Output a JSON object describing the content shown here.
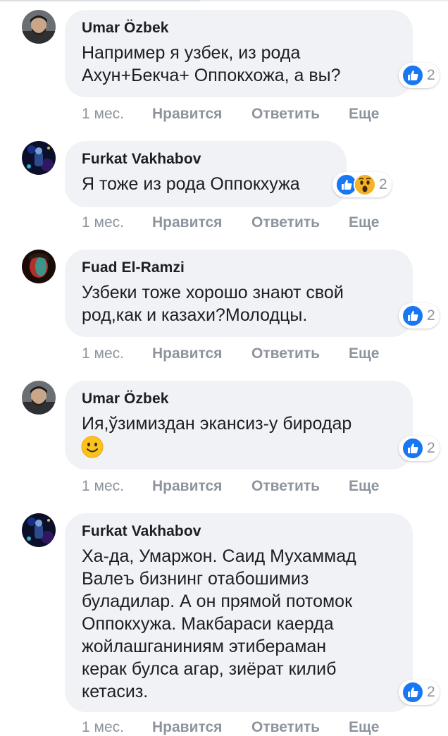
{
  "action_labels": {
    "time": "1 мес.",
    "like": "Нравится",
    "reply": "Ответить",
    "more": "Еще"
  },
  "comments": [
    {
      "author": "Umar Özbek",
      "text": "Например я узбек, из рода\nАхун+Бекча+ Оппокхожа, а вы?",
      "reaction_count": "2",
      "reactions": [
        "like-icon"
      ]
    },
    {
      "author": "Furkat Vakhabov",
      "text": "Я тоже из рода Оппокхужа",
      "reaction_count": "2",
      "reactions": [
        "like-icon",
        "wow-icon"
      ]
    },
    {
      "author": "Fuad El-Ramzi",
      "text": "Узбеки тоже хорошо знают свой\nрод,как и казахи?Молодцы.",
      "reaction_count": "2",
      "reactions": [
        "like-icon"
      ]
    },
    {
      "author": "Umar Özbek",
      "text": "Ия,ўзимиздан экансиз-у биродар",
      "emoji": "slightly-smiling-face-icon",
      "reaction_count": "2",
      "reactions": [
        "like-icon"
      ]
    },
    {
      "author": "Furkat Vakhabov",
      "text": "Ха-да, Умаржон. Саид Мухаммад\nВалеъ бизнинг отабошимиз\nбуладилар. А он прямой потомок\nОппокхужа. Макбараси каерда\nжойлашганиниям этибераман\nкерак булса агар, зиёрат килиб\nкетасиз.",
      "reaction_count": "2",
      "reactions": [
        "like-icon"
      ]
    }
  ],
  "colors": {
    "like_blue": "#1877f2",
    "bubble_bg": "#f0f2f5",
    "meta_gray": "#8d949e",
    "wow_yellow": "#f7b125"
  }
}
